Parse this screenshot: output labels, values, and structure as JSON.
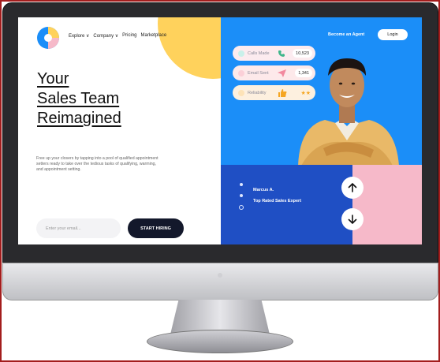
{
  "nav": {
    "items": [
      "Explore ∨",
      "Company ∨",
      "Pricing",
      "Marketplace"
    ]
  },
  "header": {
    "become_agent": "Become an Agent",
    "login": "Login"
  },
  "hero": {
    "headline": [
      "Your",
      "Sales Team",
      "Reimagined"
    ],
    "description": "Free up your closers by tapping into a pool of qualified appointment setters ready to take over the tedious tasks of qualifying, warming, and appointment setting.",
    "email_placeholder": "Enter your email...",
    "cta": "START HIRING"
  },
  "stats": [
    {
      "label": "Calls Made",
      "value": "10,523",
      "icon": "phone-icon"
    },
    {
      "label": "Email Sent",
      "value": "1,341",
      "icon": "paper-plane-icon"
    },
    {
      "label": "Reliability",
      "value": "",
      "icon": "thumbs-up-icon"
    }
  ],
  "agent": {
    "name": "Marcus A.",
    "title": "Top Rated Sales Expert"
  },
  "colors": {
    "blue": "#1b8ef8",
    "navy": "#1f4fc4",
    "pink": "#f6b9c9",
    "yellow": "#ffd25c",
    "dark": "#13182b"
  }
}
